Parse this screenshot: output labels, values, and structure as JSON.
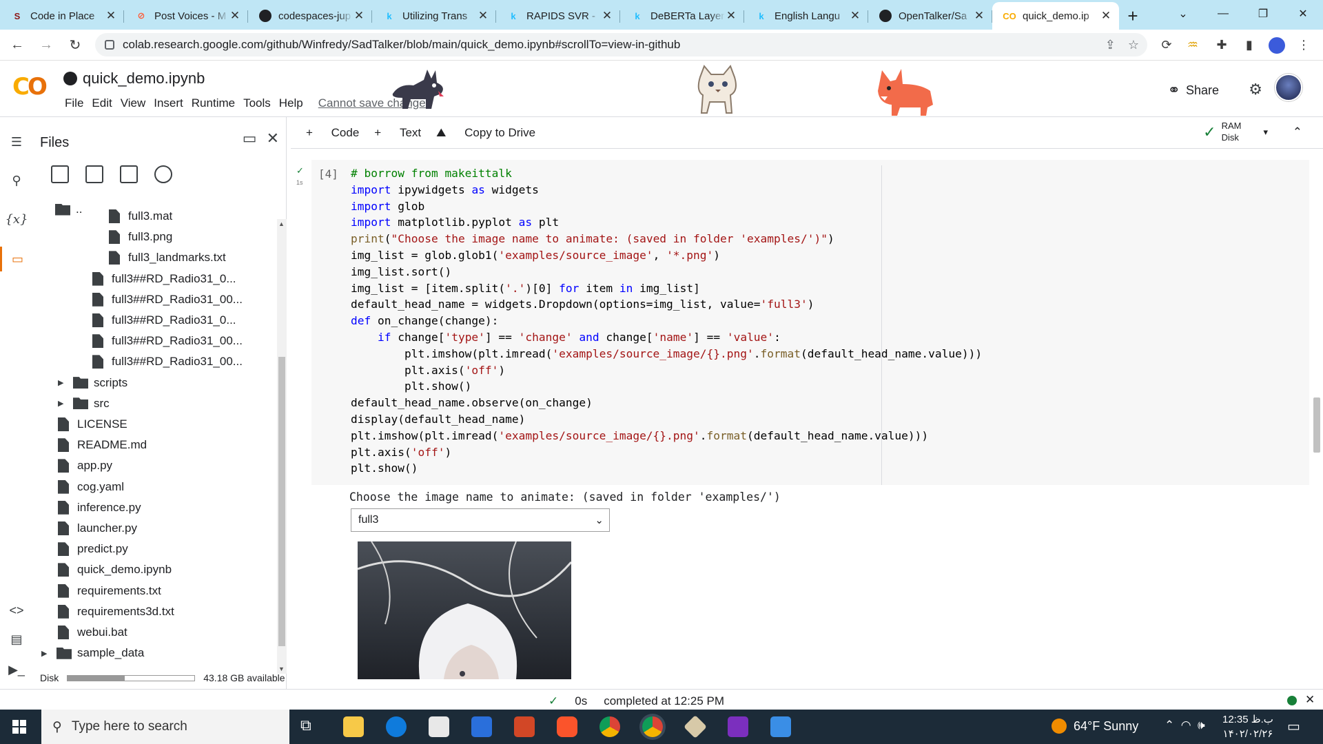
{
  "browser": {
    "tabs": [
      {
        "title": "Code in Place",
        "favicon": "stanford-icon",
        "color": "#8c1515",
        "glyph": "S"
      },
      {
        "title": "Post Voices - M",
        "favicon": "post-voices-icon",
        "color": "#ff5a36",
        "glyph": "⊘"
      },
      {
        "title": "codespaces-jup",
        "favicon": "github-icon",
        "color": "#202124",
        "glyph": ""
      },
      {
        "title": "Utilizing Trans",
        "favicon": "kaggle-icon",
        "color": "#20beff",
        "glyph": "k"
      },
      {
        "title": "RAPIDS SVR -",
        "favicon": "kaggle-icon",
        "color": "#20beff",
        "glyph": "k"
      },
      {
        "title": "DeBERTa Layer",
        "favicon": "kaggle-icon",
        "color": "#20beff",
        "glyph": "k"
      },
      {
        "title": "English Langu",
        "favicon": "kaggle-icon",
        "color": "#20beff",
        "glyph": "k"
      },
      {
        "title": "OpenTalker/Sa",
        "favicon": "github-icon",
        "color": "#202124",
        "glyph": ""
      },
      {
        "title": "quick_demo.ip",
        "favicon": "colab-icon",
        "color": "#f9ab00",
        "glyph": "CO"
      }
    ],
    "url": "colab.research.google.com/github/Winfredy/SadTalker/blob/main/quick_demo.ipynb#scrollTo=view-in-github"
  },
  "colab": {
    "logo": "CO",
    "title": "quick_demo.ipynb",
    "menu": [
      "File",
      "Edit",
      "View",
      "Insert",
      "Runtime",
      "Tools",
      "Help"
    ],
    "cannot_save": "Cannot save changes",
    "share": "Share",
    "toolbar": {
      "code": "Code",
      "text": "Text",
      "copy": "Copy to Drive",
      "ram": "RAM",
      "disk": "Disk"
    }
  },
  "files": {
    "title": "Files",
    "parent": "..",
    "items": [
      {
        "name": "full3.mat",
        "type": "file",
        "indent": 3
      },
      {
        "name": "full3.png",
        "type": "file",
        "indent": 3
      },
      {
        "name": "full3_landmarks.txt",
        "type": "file",
        "indent": 3
      },
      {
        "name": "full3##RD_Radio31_0...",
        "type": "file",
        "indent": 2
      },
      {
        "name": "full3##RD_Radio31_00...",
        "type": "file",
        "indent": 2
      },
      {
        "name": "full3##RD_Radio31_0...",
        "type": "file",
        "indent": 2
      },
      {
        "name": "full3##RD_Radio31_00...",
        "type": "file",
        "indent": 2
      },
      {
        "name": "full3##RD_Radio31_00...",
        "type": "file",
        "indent": 2
      },
      {
        "name": "scripts",
        "type": "folder",
        "indent": 1
      },
      {
        "name": "src",
        "type": "folder",
        "indent": 1
      },
      {
        "name": "LICENSE",
        "type": "file",
        "indent": 1
      },
      {
        "name": "README.md",
        "type": "file",
        "indent": 1
      },
      {
        "name": "app.py",
        "type": "file",
        "indent": 1
      },
      {
        "name": "cog.yaml",
        "type": "file",
        "indent": 1
      },
      {
        "name": "inference.py",
        "type": "file",
        "indent": 1
      },
      {
        "name": "launcher.py",
        "type": "file",
        "indent": 1
      },
      {
        "name": "predict.py",
        "type": "file",
        "indent": 1
      },
      {
        "name": "quick_demo.ipynb",
        "type": "file",
        "indent": 1
      },
      {
        "name": "requirements.txt",
        "type": "file",
        "indent": 1
      },
      {
        "name": "requirements3d.txt",
        "type": "file",
        "indent": 1
      },
      {
        "name": "webui.bat",
        "type": "file",
        "indent": 1
      },
      {
        "name": "sample_data",
        "type": "folder",
        "indent": 0
      }
    ],
    "disk_label": "Disk",
    "disk_available": "43.18 GB available",
    "disk_used_fraction": 0.45
  },
  "cell": {
    "exec_count": "[4]",
    "exec_time": "1s",
    "code_lines": [
      "# borrow from makeittalk",
      "import ipywidgets as widgets",
      "import glob",
      "import matplotlib.pyplot as plt",
      "print(\"Choose the image name to animate: (saved in folder 'examples/')\")",
      "img_list = glob.glob1('examples/source_image', '*.png')",
      "img_list.sort()",
      "img_list = [item.split('.')[0] for item in img_list]",
      "default_head_name = widgets.Dropdown(options=img_list, value='full3')",
      "def on_change(change):",
      "    if change['type'] == 'change' and change['name'] == 'value':",
      "        plt.imshow(plt.imread('examples/source_image/{}.png'.format(default_head_name.value)))",
      "        plt.axis('off')",
      "        plt.show()",
      "default_head_name.observe(on_change)",
      "display(default_head_name)",
      "plt.imshow(plt.imread('examples/source_image/{}.png'.format(default_head_name.value)))",
      "plt.axis('off')",
      "plt.show()"
    ],
    "output_text": "Choose the image name to animate: (saved in folder 'examples/')",
    "dropdown_value": "full3"
  },
  "status": {
    "time": "0s",
    "message": "completed at 12:25 PM"
  },
  "taskbar": {
    "search_placeholder": "Type here to search",
    "weather": "64°F  Sunny",
    "clock_time": "12:35 ب.ظ",
    "clock_date": "۱۴۰۲/۰۲/۲۶"
  }
}
